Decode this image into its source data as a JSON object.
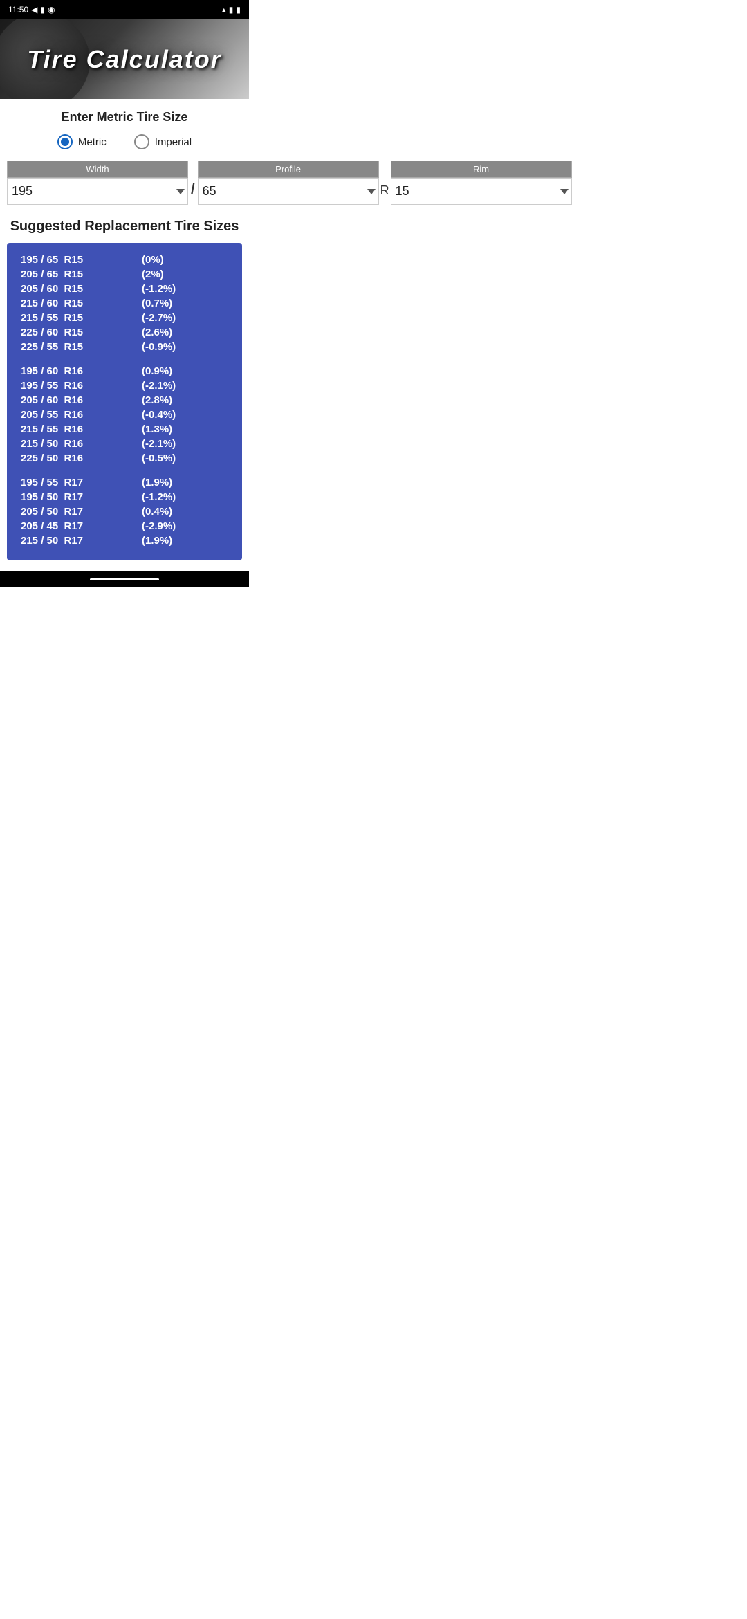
{
  "statusBar": {
    "time": "11:50",
    "icons": [
      "notification-icon",
      "sim-icon",
      "shield-icon",
      "wifi-icon",
      "signal-icon",
      "battery-icon"
    ]
  },
  "header": {
    "title": "Tire Calculator"
  },
  "form": {
    "sectionTitle": "Enter Metric Tire Size",
    "radioOptions": [
      {
        "label": "Metric",
        "checked": true
      },
      {
        "label": "Imperial",
        "checked": false
      }
    ],
    "widthLabel": "Width",
    "profileLabel": "Profile",
    "rimLabel": "Rim",
    "widthValue": "195",
    "profileValue": "65",
    "rimValue": "15",
    "separator": "/",
    "rimPrefix": "R"
  },
  "results": {
    "sectionTitle": "Suggested Replacement Tire Sizes",
    "groups": [
      {
        "items": [
          {
            "size": "195 / 65  R15",
            "pct": "(0%)"
          },
          {
            "size": "205 / 65  R15",
            "pct": "(2%)"
          },
          {
            "size": "205 / 60  R15",
            "pct": "(-1.2%)"
          },
          {
            "size": "215 / 60  R15",
            "pct": "(0.7%)"
          },
          {
            "size": "215 / 55  R15",
            "pct": "(-2.7%)"
          },
          {
            "size": "225 / 60  R15",
            "pct": "(2.6%)"
          },
          {
            "size": "225 / 55  R15",
            "pct": "(-0.9%)"
          }
        ]
      },
      {
        "items": [
          {
            "size": "195 / 60  R16",
            "pct": "(0.9%)"
          },
          {
            "size": "195 / 55  R16",
            "pct": "(-2.1%)"
          },
          {
            "size": "205 / 60  R16",
            "pct": "(2.8%)"
          },
          {
            "size": "205 / 55  R16",
            "pct": "(-0.4%)"
          },
          {
            "size": "215 / 55  R16",
            "pct": "(1.3%)"
          },
          {
            "size": "215 / 50  R16",
            "pct": "(-2.1%)"
          },
          {
            "size": "225 / 50  R16",
            "pct": "(-0.5%)"
          }
        ]
      },
      {
        "items": [
          {
            "size": "195 / 55  R17",
            "pct": "(1.9%)"
          },
          {
            "size": "195 / 50  R17",
            "pct": "(-1.2%)"
          },
          {
            "size": "205 / 50  R17",
            "pct": "(0.4%)"
          },
          {
            "size": "205 / 45  R17",
            "pct": "(-2.9%)"
          },
          {
            "size": "215 / 50  R17",
            "pct": "(1.9%)"
          }
        ]
      }
    ]
  }
}
